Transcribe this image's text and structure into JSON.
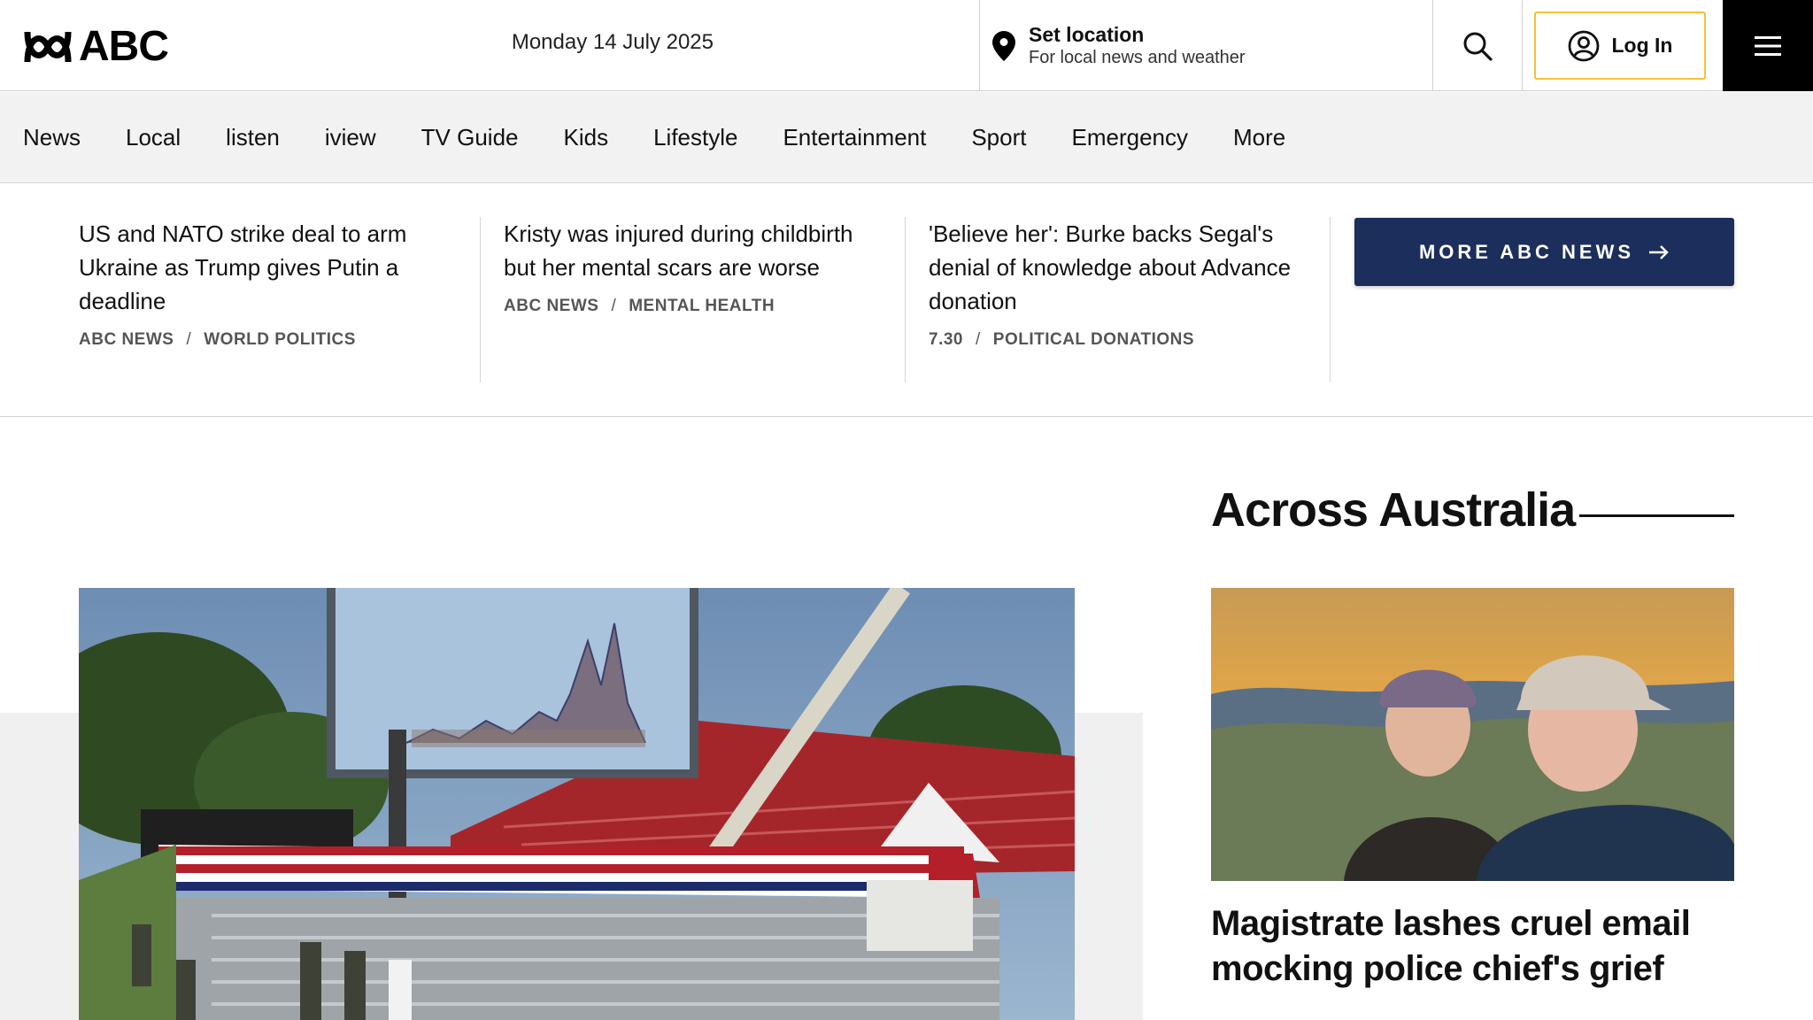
{
  "header": {
    "logo_text": "ABC",
    "date": "Monday 14 July 2025",
    "location_title": "Set location",
    "location_subtitle": "For local news and weather",
    "login_label": "Log In"
  },
  "nav": {
    "items": [
      "News",
      "Local",
      "listen",
      "iview",
      "TV Guide",
      "Kids",
      "Lifestyle",
      "Entertainment",
      "Sport",
      "Emergency",
      "More"
    ]
  },
  "stories": [
    {
      "title": "US and NATO strike deal to arm Ukraine as Trump gives Putin a deadline",
      "source": "ABC NEWS",
      "topic": "WORLD POLITICS"
    },
    {
      "title": "Kristy was injured during childbirth but her mental scars are worse",
      "source": "ABC NEWS",
      "topic": "MENTAL HEALTH"
    },
    {
      "title": "'Believe her': Burke backs Segal's denial of knowledge about Advance donation",
      "source": "7.30",
      "topic": "POLITICAL DONATIONS"
    }
  ],
  "more_news_label": "MORE ABC NEWS",
  "across": {
    "title": "Across Australia",
    "headline": "Magistrate lashes cruel email mocking police chief's grief"
  },
  "colors": {
    "brand_black": "#000000",
    "login_border": "#f4c136",
    "more_news_bg": "#1c2e5c",
    "nav_bg": "#f2f2f2"
  }
}
